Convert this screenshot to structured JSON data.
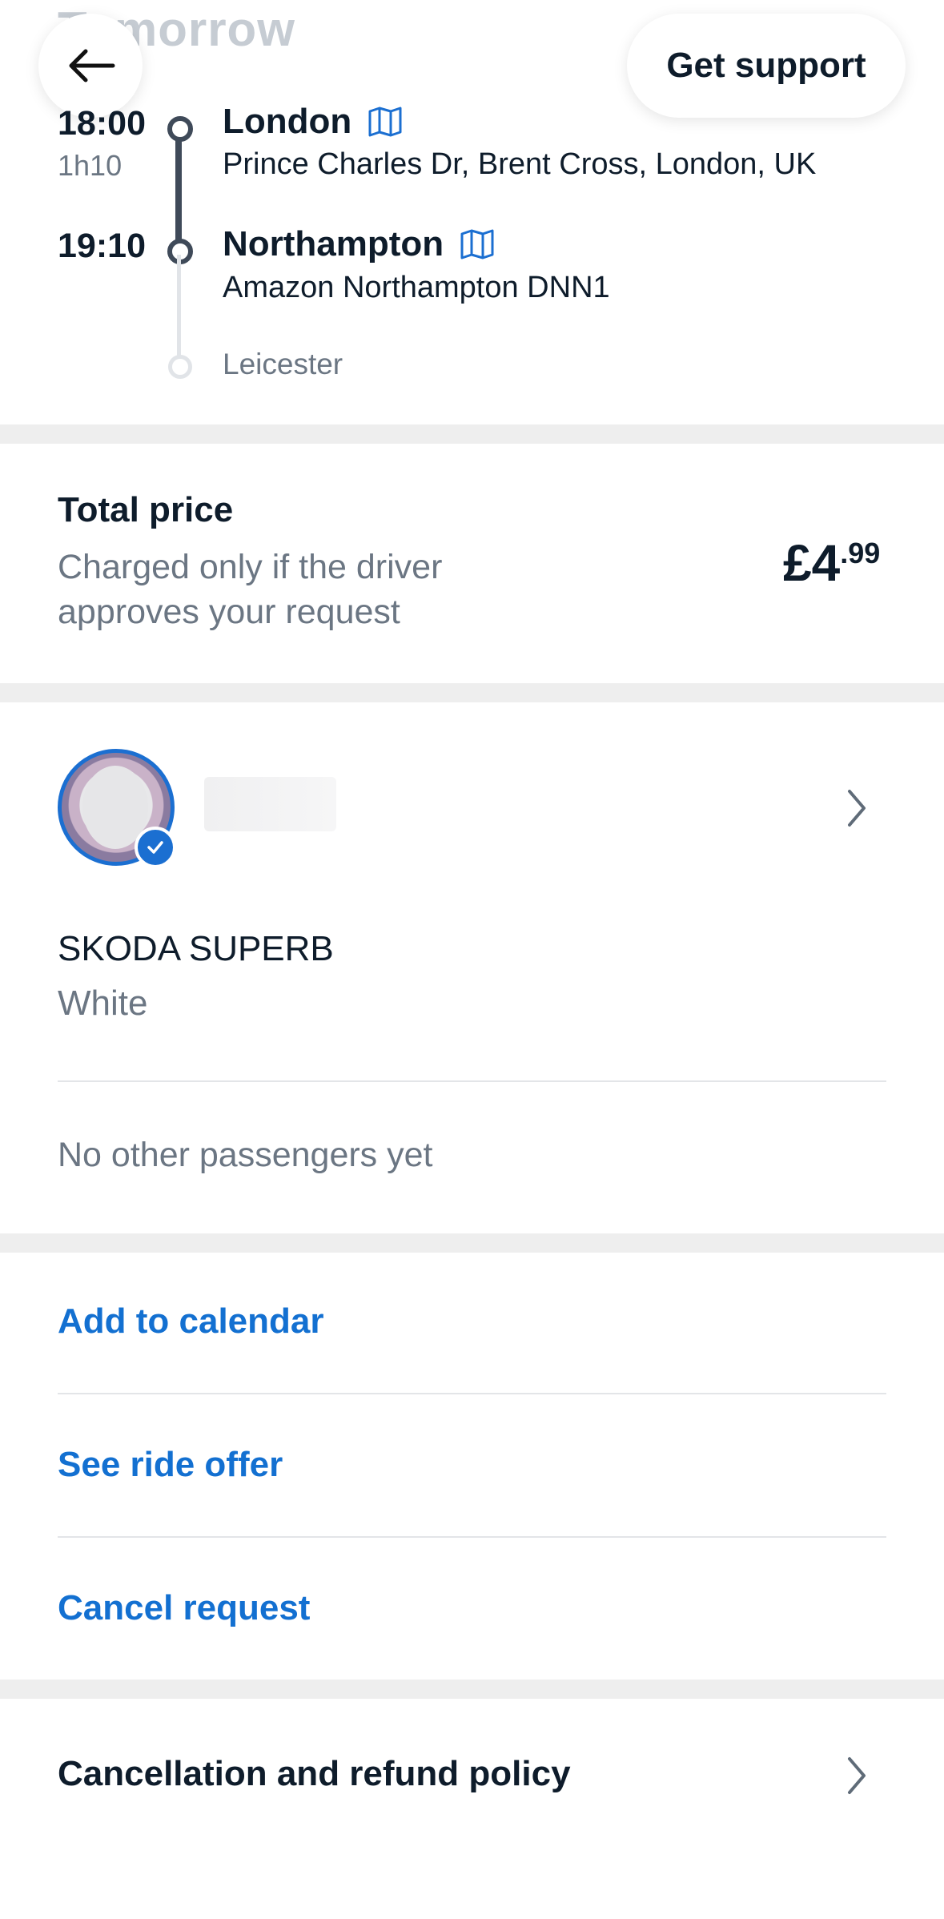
{
  "header": {
    "title": "Tomorrow",
    "back_icon": "arrow-left-icon",
    "support_label": "Get support"
  },
  "itinerary": {
    "departure": {
      "time": "18:00",
      "duration": "1h10",
      "city": "London",
      "address": "Prince Charles Dr, Brent Cross, London, UK",
      "map_icon": "map-icon"
    },
    "arrival": {
      "time": "19:10",
      "city": "Northampton",
      "address": "Amazon Northampton DNN1",
      "map_icon": "map-icon"
    },
    "final_stop": "Leicester"
  },
  "price": {
    "title": "Total price",
    "note": "Charged only if the driver approves your request",
    "main": "£4",
    "cents": ".99"
  },
  "driver": {
    "car_model": "SKODA SUPERB",
    "car_color": "White",
    "passengers": "No other passengers yet"
  },
  "actions": {
    "add_calendar": "Add to calendar",
    "see_offer": "See ride offer",
    "cancel_request": "Cancel request"
  },
  "policy": {
    "label": "Cancellation and refund policy"
  },
  "colors": {
    "accent": "#1370d1",
    "text_dark": "#0e1c2b",
    "text_muted": "#6b7683",
    "separator": "#eeeeee"
  }
}
